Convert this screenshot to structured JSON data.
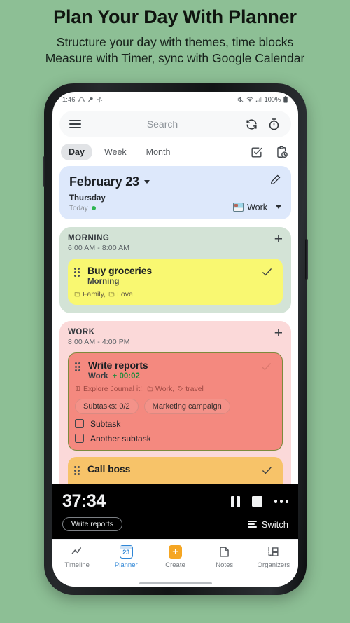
{
  "promo": {
    "title": "Plan Your Day With Planner",
    "sub_line1": "Structure your day with themes, time blocks",
    "sub_line2": "Measure with Timer, sync with Google Calendar"
  },
  "statusbar": {
    "time": "1:46",
    "left_icons": [
      "headphones-icon",
      "wrench-icon",
      "fan-icon",
      "dash-icon"
    ],
    "right_icons": [
      "mute-icon",
      "wifi-icon",
      "signal-icon"
    ],
    "battery_text": "100%",
    "battery_icon": "battery-icon"
  },
  "search": {
    "menu_icon": "hamburger-icon",
    "placeholder": "Search",
    "sync_icon": "sync-icon",
    "timer_icon": "stopwatch-icon"
  },
  "view_tabs": {
    "items": [
      {
        "label": "Day",
        "active": true
      },
      {
        "label": "Week",
        "active": false
      },
      {
        "label": "Month",
        "active": false
      }
    ],
    "right_icons": [
      "checkbox-checked-icon",
      "clipboard-clock-icon"
    ]
  },
  "date_card": {
    "date": "February 23",
    "day_of_week": "Thursday",
    "today_label": "Today",
    "theme_label": "Work",
    "theme_emoji": "desk-emoji",
    "edit_icon": "pencil-icon",
    "dropdown_icon": "chevron-down-icon",
    "bg_color": "#dde8fb"
  },
  "blocks": [
    {
      "name": "MORNING",
      "time": "6:00 AM - 8:00 AM",
      "bg_color": "#d3e3d6",
      "add_label": "+",
      "tasks": [
        {
          "title": "Buy groceries",
          "subtitle": "Morning",
          "timer": "",
          "tags": [
            "Family,",
            "Love"
          ],
          "color": "yellow",
          "chips": [],
          "subtasks": []
        }
      ]
    },
    {
      "name": "WORK",
      "time": "8:00 AM - 4:00 PM",
      "bg_color": "#fbd9d9",
      "add_label": "+",
      "tasks": [
        {
          "title": "Write reports",
          "subtitle": "Work",
          "timer": "+ 00:02",
          "tags": [
            "Explore Journal it!,",
            "Work,",
            "travel"
          ],
          "color": "red",
          "chips": [
            "Subtasks: 0/2",
            "Marketing campaign"
          ],
          "subtasks": [
            "Subtask",
            "Another subtask"
          ]
        },
        {
          "title": "Call boss",
          "subtitle": "",
          "timer": "",
          "tags": [],
          "color": "orange",
          "chips": [],
          "subtasks": []
        }
      ]
    }
  ],
  "timer_bar": {
    "elapsed": "37:34",
    "task_chip": "Write reports",
    "switch_label": "Switch",
    "controls": [
      "pause-icon",
      "stop-icon",
      "more-icon"
    ],
    "switch_icon": "list-icon",
    "bg_color": "#000000"
  },
  "bottom_nav": {
    "items": [
      {
        "label": "Timeline",
        "icon": "timeline-icon",
        "active": false
      },
      {
        "label": "Planner",
        "icon": "calendar-23-icon",
        "active": true,
        "badge": "23"
      },
      {
        "label": "Create",
        "icon": "plus-square-icon",
        "active": false
      },
      {
        "label": "Notes",
        "icon": "note-icon",
        "active": false
      },
      {
        "label": "Organizers",
        "icon": "folders-icon",
        "active": false
      }
    ],
    "accent_color": "#2f86d6",
    "create_color": "#f5a623"
  },
  "page": {
    "background_color": "#8dbf95"
  }
}
